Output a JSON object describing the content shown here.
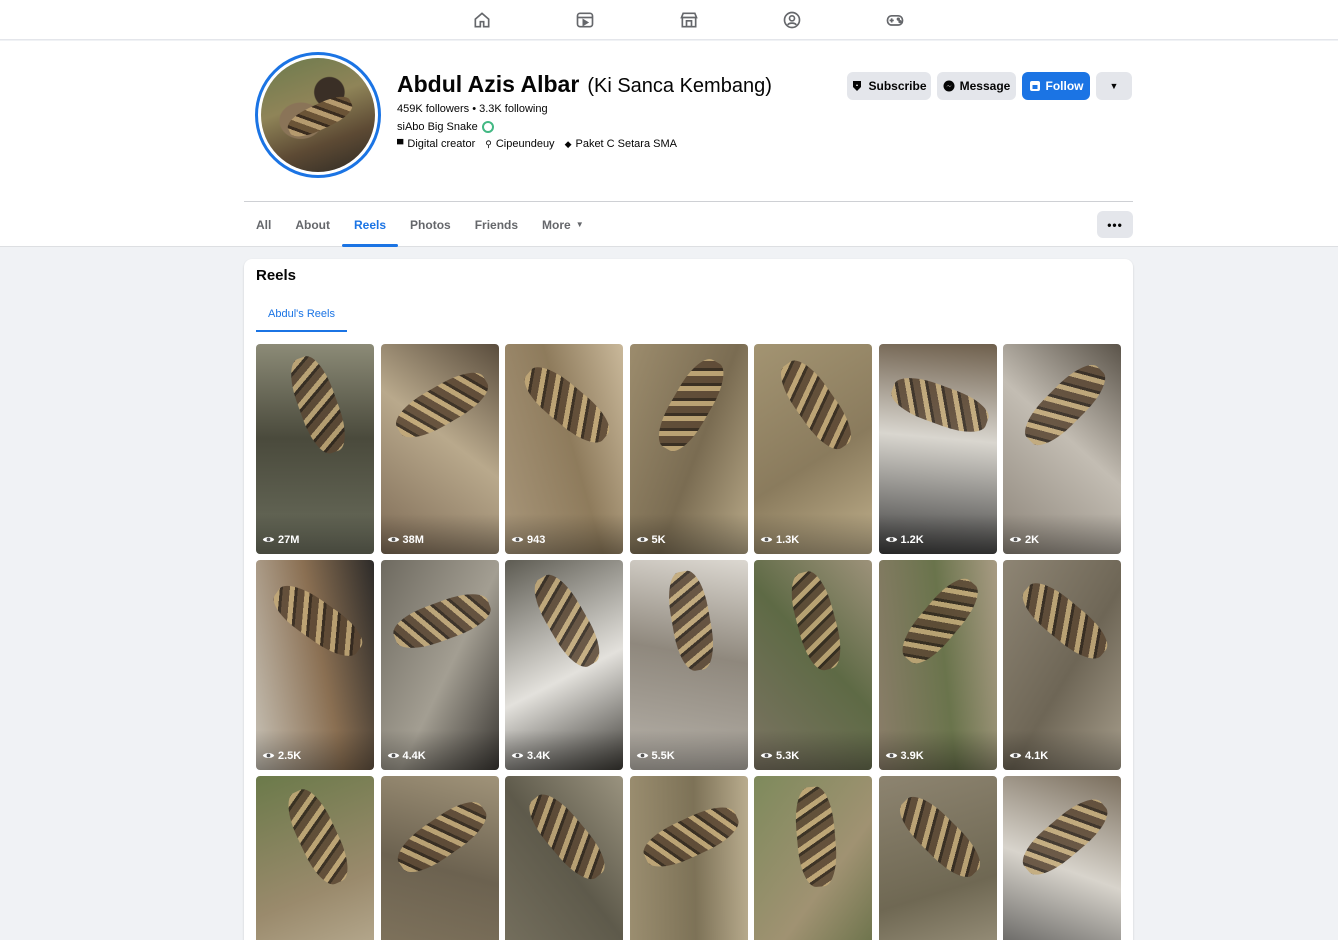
{
  "nav": {
    "icons": [
      "home-icon",
      "video-icon",
      "marketplace-icon",
      "groups-icon",
      "gaming-icon"
    ]
  },
  "profile": {
    "name": "Abdul Azis Albar",
    "alternate_name": "(Ki Sanca Kembang)",
    "stats": "459K followers • 3.3K following",
    "bio_label": "siAbo Big Snake",
    "details": [
      {
        "icon": "briefcase-icon",
        "text": "Digital creator"
      },
      {
        "icon": "location-pin-icon",
        "text": "Cipeundeuy"
      },
      {
        "icon": "graduation-cap-icon",
        "text": "Paket C Setara SMA"
      }
    ],
    "buttons": {
      "subscribe": "Subscribe",
      "message": "Message",
      "follow": "Follow"
    }
  },
  "tabs": [
    {
      "label": "All",
      "active": false
    },
    {
      "label": "About",
      "active": false
    },
    {
      "label": "Reels",
      "active": true
    },
    {
      "label": "Photos",
      "active": false
    },
    {
      "label": "Friends",
      "active": false
    },
    {
      "label": "More",
      "active": false
    }
  ],
  "reels_section": {
    "title": "Reels",
    "subtab": "Abdul's Reels",
    "items": [
      {
        "views": "27M"
      },
      {
        "views": "38M"
      },
      {
        "views": "943"
      },
      {
        "views": "5K"
      },
      {
        "views": "1.3K"
      },
      {
        "views": "1.2K"
      },
      {
        "views": "2K"
      },
      {
        "views": "2.5K"
      },
      {
        "views": "4.4K"
      },
      {
        "views": "3.4K"
      },
      {
        "views": "5.5K"
      },
      {
        "views": "5.3K"
      },
      {
        "views": "3.9K"
      },
      {
        "views": "4.1K"
      },
      {
        "views": ""
      },
      {
        "views": ""
      },
      {
        "views": ""
      },
      {
        "views": ""
      },
      {
        "views": ""
      },
      {
        "views": ""
      },
      {
        "views": ""
      }
    ]
  },
  "colors": {
    "accent": "#1b74e4",
    "background": "#f0f2f5"
  }
}
